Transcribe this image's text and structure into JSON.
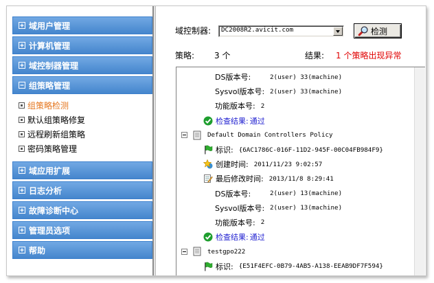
{
  "colors": {
    "sidebar_blue": "#4a90dc",
    "selected_orange": "#e5761e",
    "alert_red": "#e00000",
    "pass_blue": "#1f1fd0",
    "pass_green": "#1e9e2e"
  },
  "sidebar": {
    "groups": [
      {
        "label": "域用户管理",
        "icon": "expand-plus-icon"
      },
      {
        "label": "计算机管理",
        "icon": "expand-plus-icon"
      },
      {
        "label": "域控制器管理",
        "icon": "expand-plus-icon"
      },
      {
        "label": "组策略管理",
        "icon": "collapse-minus-icon",
        "expanded": true,
        "items": [
          {
            "label": "组策略检测",
            "selected": true
          },
          {
            "label": "默认组策略修复"
          },
          {
            "label": "远程刷新组策略"
          },
          {
            "label": "密码策略管理"
          }
        ]
      },
      {
        "label": "域应用扩展",
        "icon": "expand-plus-icon"
      },
      {
        "label": "日志分析",
        "icon": "expand-plus-icon"
      },
      {
        "label": "故障诊断中心",
        "icon": "expand-plus-icon"
      },
      {
        "label": "管理员选项",
        "icon": "expand-plus-icon"
      },
      {
        "label": "帮助",
        "icon": "expand-plus-icon"
      }
    ]
  },
  "toolbar": {
    "dc_label": "域控制器:",
    "dc_selected": "DC2008R2.avicit.com",
    "dc_dropdown_icon": "chevron-down-icon",
    "detect_button_label": "检测",
    "detect_button_icon": "magnifier-icon"
  },
  "summary": {
    "policy_label": "策略:",
    "policy_count": "3 个",
    "result_label": "结果:",
    "result_text": "1 个策略出现异常"
  },
  "tree": {
    "policies": [
      {
        "details": [
          {
            "label": "DS版本号:",
            "value": "2(user) 33(machine)"
          },
          {
            "label": "Sysvol版本号:",
            "value": "2(user) 33(machine)"
          },
          {
            "label": "功能版本号:",
            "value": "2"
          }
        ],
        "check": {
          "label": "检查结果:",
          "value": "通过",
          "icon": "check-circle-icon"
        }
      },
      {
        "name": "Default Domain Controllers Policy",
        "expanded": true,
        "id": {
          "label": "标识:",
          "value": "{6AC1786C-016F-11D2-945F-00C04FB984F9}",
          "icon": "flag-icon"
        },
        "created": {
          "label": "创建时间:",
          "value": "2011/11/23 9:02:57",
          "icon": "star-icon"
        },
        "modified": {
          "label": "最后修改时间:",
          "value": "2013/11/8 8:29:41",
          "icon": "edit-icon"
        },
        "details": [
          {
            "label": "DS版本号:",
            "value": "2(user) 13(machine)"
          },
          {
            "label": "Sysvol版本号:",
            "value": "2(user) 13(machine)"
          },
          {
            "label": "功能版本号:",
            "value": "2"
          }
        ],
        "check": {
          "label": "检查结果:",
          "value": "通过",
          "icon": "check-circle-icon"
        }
      },
      {
        "name": "testgpo222",
        "expanded": true,
        "id": {
          "label": "标识:",
          "value": "{E51F4EFC-0B79-4AB5-A138-EEAB9DF7F594}",
          "icon": "flag-icon"
        }
      }
    ]
  }
}
